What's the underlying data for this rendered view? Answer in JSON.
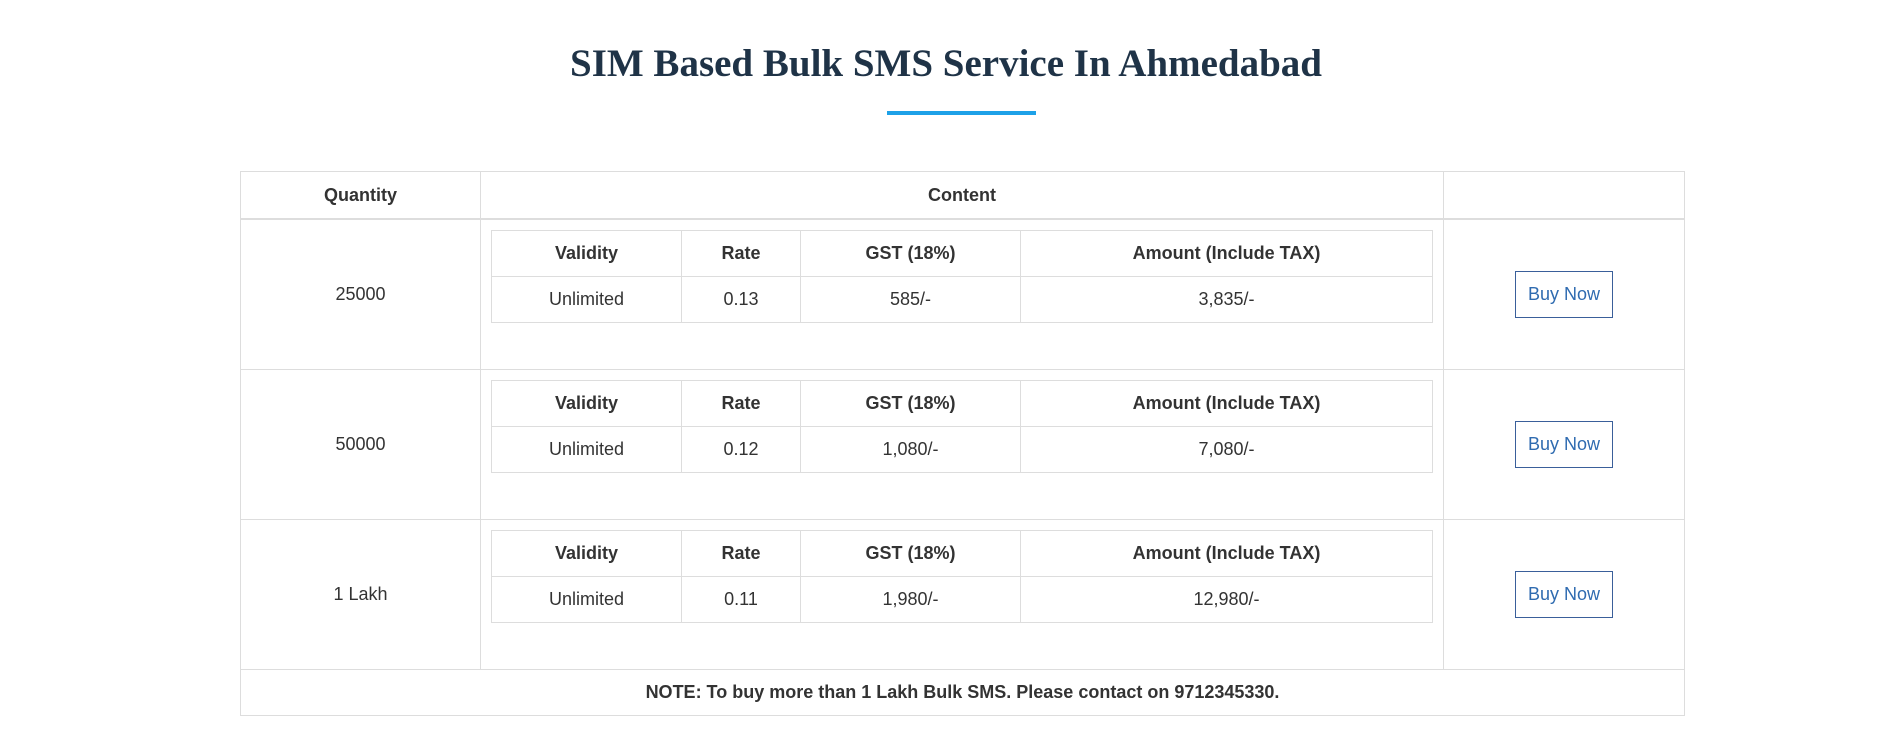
{
  "page": {
    "title": "SIM Based Bulk SMS Service In Ahmedabad"
  },
  "colors": {
    "title": "#1f3347",
    "accent_underline": "#1da1e8",
    "border": "#dddddd",
    "button_text": "#2f6bb0"
  },
  "table": {
    "headers": {
      "quantity": "Quantity",
      "content": "Content",
      "action": ""
    },
    "inner_headers": {
      "validity": "Validity",
      "rate": "Rate",
      "gst": "GST (18%)",
      "amount": "Amount (Include TAX)"
    },
    "rows": [
      {
        "quantity": "25000",
        "validity": "Unlimited",
        "rate": "0.13",
        "gst": "585/-",
        "amount": "3,835/-",
        "button": "Buy Now"
      },
      {
        "quantity": "50000",
        "validity": "Unlimited",
        "rate": "0.12",
        "gst": "1,080/-",
        "amount": "7,080/-",
        "button": "Buy Now"
      },
      {
        "quantity": "1 Lakh",
        "validity": "Unlimited",
        "rate": "0.11",
        "gst": "1,980/-",
        "amount": "12,980/-",
        "button": "Buy Now"
      }
    ],
    "note": "NOTE: To buy more than 1 Lakh Bulk SMS. Please contact on 9712345330."
  }
}
